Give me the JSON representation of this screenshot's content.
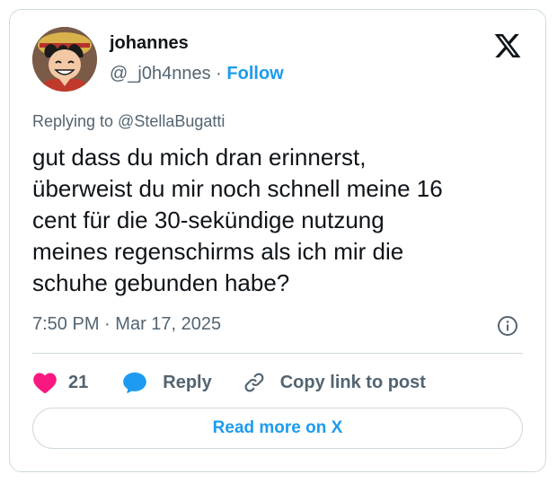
{
  "author": {
    "name": "johannes",
    "handle": "@_j0h4nnes",
    "separator": "·",
    "follow_label": "Follow",
    "avatar_icon": "anime-avatar"
  },
  "brand": {
    "icon": "x-logo-icon"
  },
  "tweet": {
    "reply_to": "Replying to @StellaBugatti",
    "text": "gut dass du mich dran erinnerst,\nüberweist du mir noch schnell meine 16\ncent für die 30-sekündige nutzung\nmeines regenschirms als ich mir die\nschuhe gebunden habe?",
    "time": "7:50 PM",
    "separator": "·",
    "date": "Mar 17, 2025"
  },
  "actions": {
    "like_count": "21",
    "reply_label": "Reply",
    "copy_label": "Copy link to post"
  },
  "read_more_label": "Read more on X",
  "colors": {
    "accent": "#1d9bf0",
    "heart": "#f91880",
    "text": "#0f1419",
    "muted": "#536471",
    "border": "#cfd9de"
  }
}
